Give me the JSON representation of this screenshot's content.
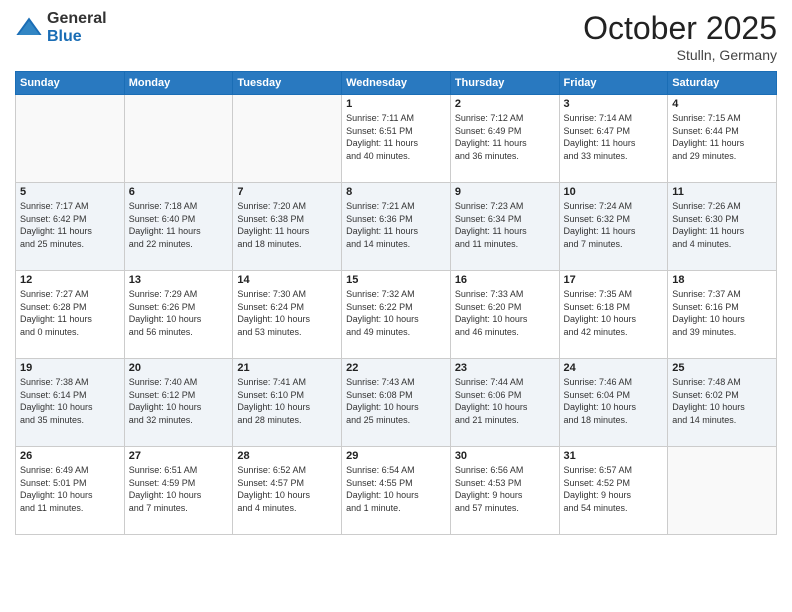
{
  "logo": {
    "general": "General",
    "blue": "Blue"
  },
  "header": {
    "month": "October 2025",
    "location": "Stulln, Germany"
  },
  "days_of_week": [
    "Sunday",
    "Monday",
    "Tuesday",
    "Wednesday",
    "Thursday",
    "Friday",
    "Saturday"
  ],
  "weeks": [
    [
      {
        "day": "",
        "info": ""
      },
      {
        "day": "",
        "info": ""
      },
      {
        "day": "",
        "info": ""
      },
      {
        "day": "1",
        "info": "Sunrise: 7:11 AM\nSunset: 6:51 PM\nDaylight: 11 hours\nand 40 minutes."
      },
      {
        "day": "2",
        "info": "Sunrise: 7:12 AM\nSunset: 6:49 PM\nDaylight: 11 hours\nand 36 minutes."
      },
      {
        "day": "3",
        "info": "Sunrise: 7:14 AM\nSunset: 6:47 PM\nDaylight: 11 hours\nand 33 minutes."
      },
      {
        "day": "4",
        "info": "Sunrise: 7:15 AM\nSunset: 6:44 PM\nDaylight: 11 hours\nand 29 minutes."
      }
    ],
    [
      {
        "day": "5",
        "info": "Sunrise: 7:17 AM\nSunset: 6:42 PM\nDaylight: 11 hours\nand 25 minutes."
      },
      {
        "day": "6",
        "info": "Sunrise: 7:18 AM\nSunset: 6:40 PM\nDaylight: 11 hours\nand 22 minutes."
      },
      {
        "day": "7",
        "info": "Sunrise: 7:20 AM\nSunset: 6:38 PM\nDaylight: 11 hours\nand 18 minutes."
      },
      {
        "day": "8",
        "info": "Sunrise: 7:21 AM\nSunset: 6:36 PM\nDaylight: 11 hours\nand 14 minutes."
      },
      {
        "day": "9",
        "info": "Sunrise: 7:23 AM\nSunset: 6:34 PM\nDaylight: 11 hours\nand 11 minutes."
      },
      {
        "day": "10",
        "info": "Sunrise: 7:24 AM\nSunset: 6:32 PM\nDaylight: 11 hours\nand 7 minutes."
      },
      {
        "day": "11",
        "info": "Sunrise: 7:26 AM\nSunset: 6:30 PM\nDaylight: 11 hours\nand 4 minutes."
      }
    ],
    [
      {
        "day": "12",
        "info": "Sunrise: 7:27 AM\nSunset: 6:28 PM\nDaylight: 11 hours\nand 0 minutes."
      },
      {
        "day": "13",
        "info": "Sunrise: 7:29 AM\nSunset: 6:26 PM\nDaylight: 10 hours\nand 56 minutes."
      },
      {
        "day": "14",
        "info": "Sunrise: 7:30 AM\nSunset: 6:24 PM\nDaylight: 10 hours\nand 53 minutes."
      },
      {
        "day": "15",
        "info": "Sunrise: 7:32 AM\nSunset: 6:22 PM\nDaylight: 10 hours\nand 49 minutes."
      },
      {
        "day": "16",
        "info": "Sunrise: 7:33 AM\nSunset: 6:20 PM\nDaylight: 10 hours\nand 46 minutes."
      },
      {
        "day": "17",
        "info": "Sunrise: 7:35 AM\nSunset: 6:18 PM\nDaylight: 10 hours\nand 42 minutes."
      },
      {
        "day": "18",
        "info": "Sunrise: 7:37 AM\nSunset: 6:16 PM\nDaylight: 10 hours\nand 39 minutes."
      }
    ],
    [
      {
        "day": "19",
        "info": "Sunrise: 7:38 AM\nSunset: 6:14 PM\nDaylight: 10 hours\nand 35 minutes."
      },
      {
        "day": "20",
        "info": "Sunrise: 7:40 AM\nSunset: 6:12 PM\nDaylight: 10 hours\nand 32 minutes."
      },
      {
        "day": "21",
        "info": "Sunrise: 7:41 AM\nSunset: 6:10 PM\nDaylight: 10 hours\nand 28 minutes."
      },
      {
        "day": "22",
        "info": "Sunrise: 7:43 AM\nSunset: 6:08 PM\nDaylight: 10 hours\nand 25 minutes."
      },
      {
        "day": "23",
        "info": "Sunrise: 7:44 AM\nSunset: 6:06 PM\nDaylight: 10 hours\nand 21 minutes."
      },
      {
        "day": "24",
        "info": "Sunrise: 7:46 AM\nSunset: 6:04 PM\nDaylight: 10 hours\nand 18 minutes."
      },
      {
        "day": "25",
        "info": "Sunrise: 7:48 AM\nSunset: 6:02 PM\nDaylight: 10 hours\nand 14 minutes."
      }
    ],
    [
      {
        "day": "26",
        "info": "Sunrise: 6:49 AM\nSunset: 5:01 PM\nDaylight: 10 hours\nand 11 minutes."
      },
      {
        "day": "27",
        "info": "Sunrise: 6:51 AM\nSunset: 4:59 PM\nDaylight: 10 hours\nand 7 minutes."
      },
      {
        "day": "28",
        "info": "Sunrise: 6:52 AM\nSunset: 4:57 PM\nDaylight: 10 hours\nand 4 minutes."
      },
      {
        "day": "29",
        "info": "Sunrise: 6:54 AM\nSunset: 4:55 PM\nDaylight: 10 hours\nand 1 minute."
      },
      {
        "day": "30",
        "info": "Sunrise: 6:56 AM\nSunset: 4:53 PM\nDaylight: 9 hours\nand 57 minutes."
      },
      {
        "day": "31",
        "info": "Sunrise: 6:57 AM\nSunset: 4:52 PM\nDaylight: 9 hours\nand 54 minutes."
      },
      {
        "day": "",
        "info": ""
      }
    ]
  ]
}
